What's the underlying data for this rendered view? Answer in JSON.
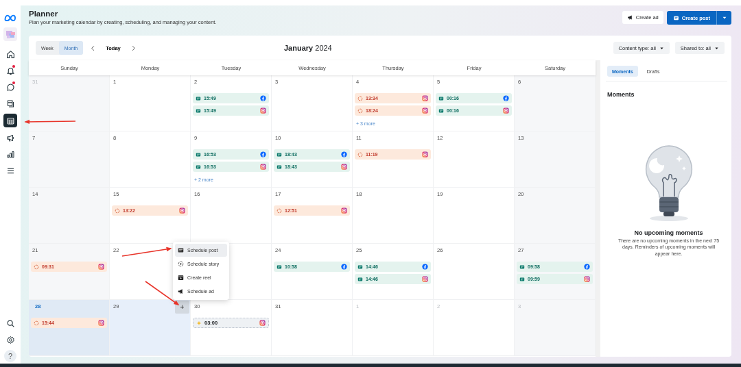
{
  "sidebar": {
    "items": [
      {
        "selected": false,
        "dot": false
      },
      {
        "selected": false,
        "dot": true
      },
      {
        "selected": false,
        "dot": true
      },
      {
        "selected": false,
        "dot": false
      },
      {
        "selected": true,
        "dot": false
      },
      {
        "selected": false,
        "dot": false
      },
      {
        "selected": false,
        "dot": false
      },
      {
        "selected": false,
        "dot": false
      }
    ],
    "bottom_items": [
      {
        "kind": "search"
      },
      {
        "kind": "settings"
      },
      {
        "kind": "help",
        "label": "?"
      }
    ]
  },
  "header": {
    "title": "Planner",
    "subtitle": "Plan your marketing calendar by creating, scheduling, and managing your content.",
    "buttons": [
      {
        "kind": "ad",
        "label": "Create ad"
      },
      {
        "kind": "post",
        "label": "Create post"
      }
    ]
  },
  "toolbar": {
    "views": [
      {
        "label": "Week",
        "selected": false
      },
      {
        "label": "Month",
        "selected": true
      }
    ],
    "today": "Today",
    "month_title": "**January** 2024",
    "filters": [
      "Content type: all",
      "Shared to: all"
    ]
  },
  "calendar": {
    "weekdays": [
      "Sunday",
      "Monday",
      "Tuesday",
      "Wednesday",
      "Thursday",
      "Friday",
      "Saturday"
    ],
    "weeks": [
      [
        {
          "day": "31",
          "muted": true,
          "today": false,
          "highlighted": false
        },
        {
          "day": "1",
          "muted": false,
          "today": false,
          "highlighted": false
        },
        {
          "day": "2",
          "muted": false,
          "today": false,
          "highlighted": false,
          "events": [
            {
              "kind": "post",
              "time": "15:49",
              "network": {
                "kind": "facebook"
              }
            },
            {
              "kind": "post",
              "time": "15:49",
              "network": {
                "kind": "instagram"
              }
            }
          ]
        },
        {
          "day": "3",
          "muted": false,
          "today": false,
          "highlighted": false
        },
        {
          "day": "4",
          "muted": false,
          "today": false,
          "highlighted": false,
          "events": [
            {
              "kind": "story",
              "time": "13:34",
              "network": {
                "kind": "instagram"
              }
            },
            {
              "kind": "story",
              "time": "18:24",
              "network": {
                "kind": "instagram"
              }
            }
          ],
          "more": "+ 3 more"
        },
        {
          "day": "5",
          "muted": false,
          "today": false,
          "highlighted": false,
          "events": [
            {
              "kind": "post",
              "time": "00:16",
              "network": {
                "kind": "facebook"
              }
            },
            {
              "kind": "post",
              "time": "00:16",
              "network": {
                "kind": "instagram"
              }
            }
          ]
        },
        {
          "day": "6",
          "muted": false,
          "today": false,
          "highlighted": false
        }
      ],
      [
        {
          "day": "7",
          "muted": false,
          "today": false,
          "highlighted": false
        },
        {
          "day": "8",
          "muted": false,
          "today": false,
          "highlighted": false
        },
        {
          "day": "9",
          "muted": false,
          "today": false,
          "highlighted": false,
          "events": [
            {
              "kind": "post",
              "time": "16:53",
              "network": {
                "kind": "facebook"
              }
            },
            {
              "kind": "post",
              "time": "16:53",
              "network": {
                "kind": "instagram"
              }
            }
          ],
          "more": "+ 2 more"
        },
        {
          "day": "10",
          "muted": false,
          "today": false,
          "highlighted": false,
          "events": [
            {
              "kind": "post",
              "time": "18:43",
              "network": {
                "kind": "facebook"
              }
            },
            {
              "kind": "post",
              "time": "18:43",
              "network": {
                "kind": "instagram"
              }
            }
          ]
        },
        {
          "day": "11",
          "muted": false,
          "today": false,
          "highlighted": false,
          "events": [
            {
              "kind": "story",
              "time": "11:19",
              "network": {
                "kind": "instagram"
              }
            }
          ]
        },
        {
          "day": "12",
          "muted": false,
          "today": false,
          "highlighted": false
        },
        {
          "day": "13",
          "muted": false,
          "today": false,
          "highlighted": false
        }
      ],
      [
        {
          "day": "14",
          "muted": false,
          "today": false,
          "highlighted": false
        },
        {
          "day": "15",
          "muted": false,
          "today": false,
          "highlighted": false,
          "events": [
            {
              "kind": "story",
              "time": "13:22",
              "network": {
                "kind": "instagram"
              }
            }
          ]
        },
        {
          "day": "16",
          "muted": false,
          "today": false,
          "highlighted": false
        },
        {
          "day": "17",
          "muted": false,
          "today": false,
          "highlighted": false,
          "events": [
            {
              "kind": "story",
              "time": "12:51",
              "network": {
                "kind": "instagram"
              }
            }
          ]
        },
        {
          "day": "18",
          "muted": false,
          "today": false,
          "highlighted": false
        },
        {
          "day": "19",
          "muted": false,
          "today": false,
          "highlighted": false
        },
        {
          "day": "20",
          "muted": false,
          "today": false,
          "highlighted": false
        }
      ],
      [
        {
          "day": "21",
          "muted": false,
          "today": false,
          "highlighted": false,
          "events": [
            {
              "kind": "story",
              "time": "09:31",
              "network": {
                "kind": "instagram"
              }
            }
          ]
        },
        {
          "day": "22",
          "muted": false,
          "today": false,
          "highlighted": false
        },
        {
          "highlighted": false
        },
        {
          "day": "24",
          "muted": false,
          "today": false,
          "highlighted": false,
          "events": [
            {
              "kind": "post",
              "time": "10:58",
              "network": {
                "kind": "facebook"
              }
            }
          ]
        },
        {
          "day": "25",
          "muted": false,
          "today": false,
          "highlighted": false,
          "events": [
            {
              "kind": "post",
              "time": "14:46",
              "network": {
                "kind": "facebook"
              }
            },
            {
              "kind": "post",
              "time": "14:46",
              "network": {
                "kind": "instagram"
              }
            }
          ]
        },
        {
          "day": "26",
          "muted": false,
          "today": false,
          "highlighted": false
        },
        {
          "day": "27",
          "muted": false,
          "today": false,
          "highlighted": false,
          "events": [
            {
              "kind": "post",
              "time": "09:58",
              "network": {
                "kind": "facebook"
              }
            },
            {
              "kind": "post",
              "time": "09:59",
              "network": {
                "kind": "instagram"
              }
            }
          ]
        }
      ],
      [
        {
          "day": "28",
          "muted": false,
          "today": true,
          "highlighted": true,
          "events": [
            {
              "kind": "story",
              "time": "15:44",
              "network": {
                "kind": "instagram"
              }
            }
          ]
        },
        {
          "day": "29",
          "muted": false,
          "today": false,
          "highlighted": true,
          "plus": "+"
        },
        {
          "day": "30",
          "muted": false,
          "today": false,
          "highlighted": false,
          "events": [
            {
              "kind": "draft",
              "time": "03:00",
              "network": {
                "kind": "instagram"
              }
            }
          ]
        },
        {
          "day": "31",
          "muted": false,
          "today": false,
          "highlighted": false
        },
        {
          "day": "1",
          "muted": true,
          "today": false,
          "highlighted": false
        },
        {
          "day": "2",
          "muted": true,
          "today": false,
          "highlighted": false
        },
        {
          "day": "3",
          "muted": true,
          "today": false,
          "highlighted": false
        }
      ]
    ]
  },
  "menu": {
    "items": [
      {
        "label": "Schedule post",
        "selected": true
      },
      {
        "label": "Schedule story",
        "selected": false
      },
      {
        "label": "Create reel",
        "selected": false
      },
      {
        "label": "Schedule ad",
        "selected": false
      }
    ]
  },
  "panel": {
    "tabs": [
      {
        "label": "Moments",
        "selected": true
      },
      {
        "label": "Drafts",
        "selected": false
      }
    ],
    "heading": "Moments",
    "empty_title": "No upcoming moments",
    "empty_text": "There are no upcoming moments in the next 75 days. Reminders of upcoming moments will appear here."
  }
}
